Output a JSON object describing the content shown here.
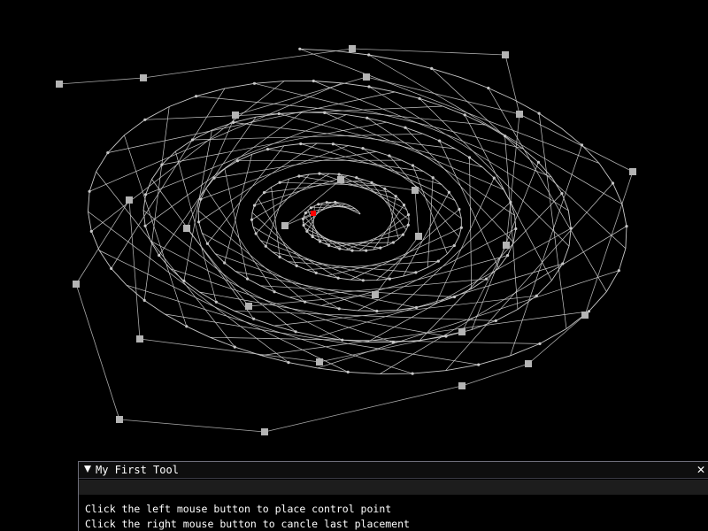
{
  "window": {
    "background_color": "#000000"
  },
  "canvas": {
    "curve_color": "#c8c8c8",
    "control_point_color": "#b4b4b4",
    "active_point_color": "#ff0000"
  },
  "tool_window": {
    "title": "My First Tool",
    "collapse_icon": "triangle-down-icon",
    "close_icon": "close-icon",
    "close_symbol": "✕",
    "input_value": "",
    "help_lines": [
      "Click the left mouse button to place control point",
      "Click the right mouse button to cancle last placement"
    ]
  }
}
